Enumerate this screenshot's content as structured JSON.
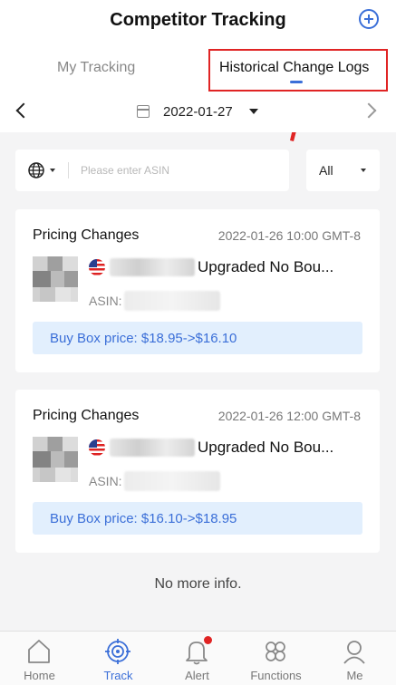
{
  "header": {
    "title": "Competitor Tracking"
  },
  "tabs": [
    {
      "label": "My Tracking"
    },
    {
      "label": "Historical Change Logs"
    }
  ],
  "date_bar": {
    "date": "2022-01-27"
  },
  "search": {
    "placeholder": "Please enter ASIN"
  },
  "filter": {
    "label": "All"
  },
  "cards": [
    {
      "title": "Pricing Changes",
      "time": "2022-01-26 10:00 GMT-8",
      "product_title": "Upgraded No Bou...",
      "asin_label": "ASIN:",
      "change": "Buy Box price: $18.95->$16.10"
    },
    {
      "title": "Pricing Changes",
      "time": "2022-01-26 12:00 GMT-8",
      "product_title": "Upgraded No Bou...",
      "asin_label": "ASIN:",
      "change": "Buy Box price: $16.10->$18.95"
    }
  ],
  "footer_note": "No more info.",
  "bottom_nav": [
    {
      "label": "Home",
      "icon": "home-icon"
    },
    {
      "label": "Track",
      "icon": "target-icon"
    },
    {
      "label": "Alert",
      "icon": "bell-icon"
    },
    {
      "label": "Functions",
      "icon": "functions-icon"
    },
    {
      "label": "Me",
      "icon": "user-icon"
    }
  ],
  "colors": {
    "accent": "#3b6fd8",
    "highlight": "#e02424",
    "change_bg": "#e2effd"
  }
}
